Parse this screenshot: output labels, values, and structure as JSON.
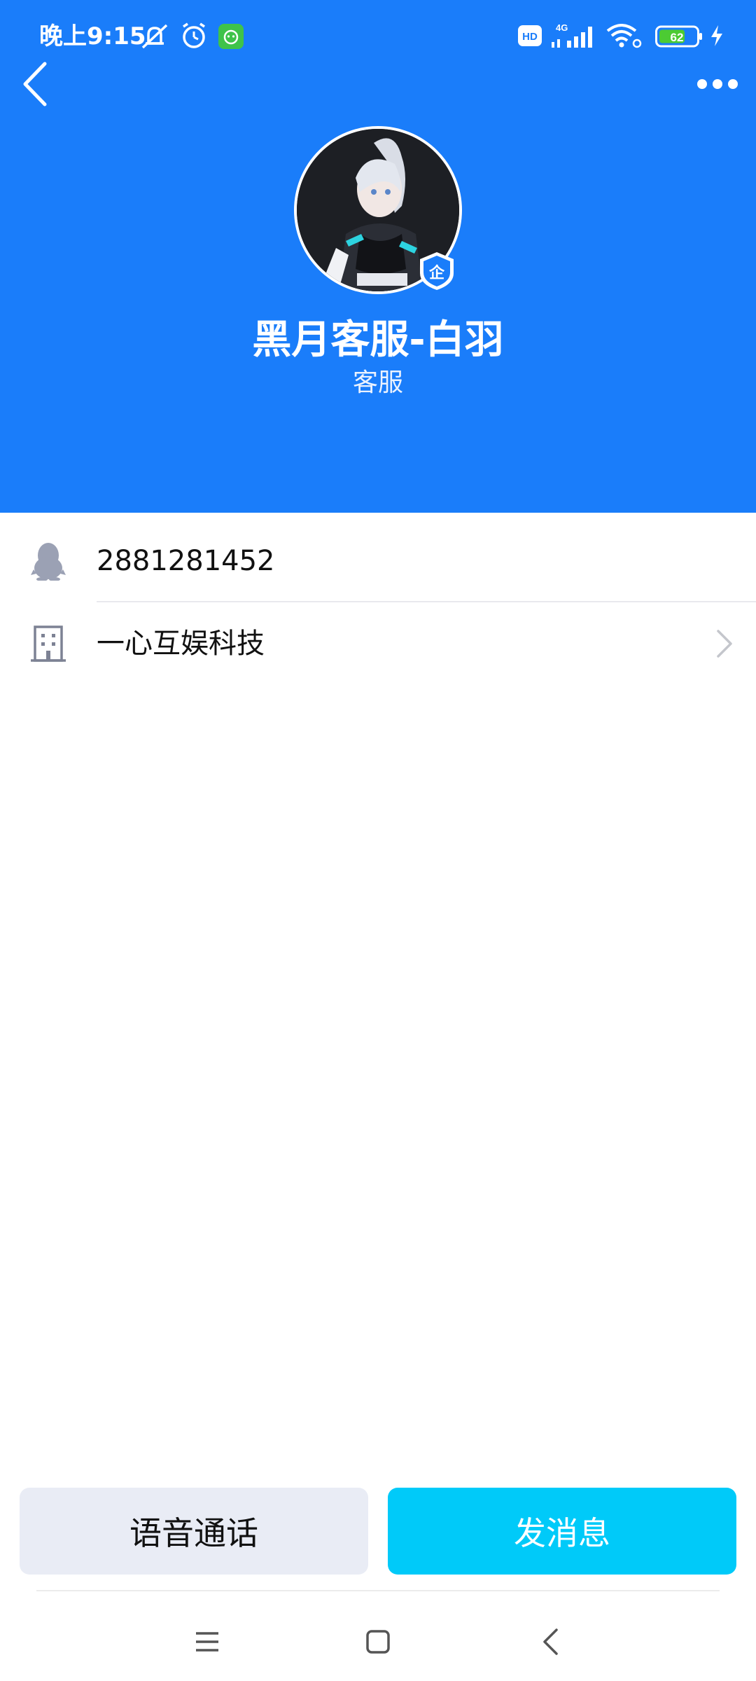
{
  "status_bar": {
    "time": "晚上9:15",
    "battery": "62",
    "network": "4G",
    "hd": "HD",
    "icons": [
      "mute-bell-icon",
      "alarm-icon",
      "app-notification-icon",
      "hd-icon",
      "signal-icon",
      "wifi-icon",
      "battery-icon",
      "charging-icon"
    ]
  },
  "header": {
    "back_icon": "back-chevron-icon",
    "more_icon": "more-dots-icon",
    "background_color": "#1a7dfa"
  },
  "profile": {
    "name": "黑月客服-白羽",
    "role": "客服",
    "badge": "企"
  },
  "info": {
    "qq_number": "2881281452",
    "company": "一心互娱科技"
  },
  "actions": {
    "voice_call": "语音通话",
    "send_message": "发消息",
    "message_color": "#00caf9"
  },
  "nav": {
    "icons": [
      "menu-icon",
      "home-square-icon",
      "back-triangle-icon"
    ]
  }
}
